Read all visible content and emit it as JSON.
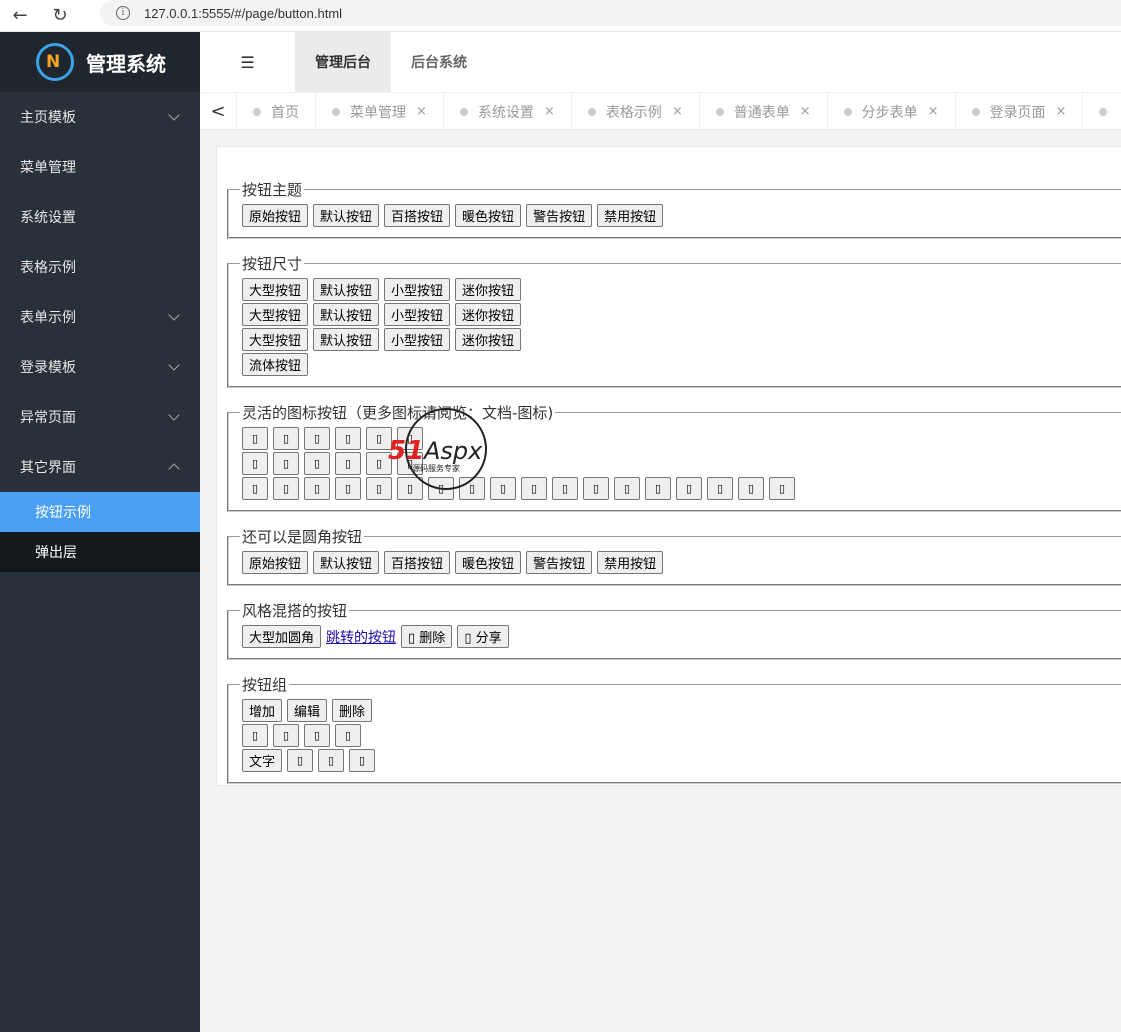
{
  "browser": {
    "url": "127.0.0.1:5555/#/page/button.html",
    "back_glyph": "←",
    "reload_glyph": "↻",
    "info_glyph": "i"
  },
  "logo": {
    "text": "管理系统",
    "mark": "N"
  },
  "sidebar": {
    "items": [
      {
        "label": "主页模板",
        "chevron": "down"
      },
      {
        "label": "菜单管理"
      },
      {
        "label": "系统设置"
      },
      {
        "label": "表格示例"
      },
      {
        "label": "表单示例",
        "chevron": "down"
      },
      {
        "label": "登录模板",
        "chevron": "down"
      },
      {
        "label": "异常页面",
        "chevron": "down"
      },
      {
        "label": "其它界面",
        "chevron": "up"
      }
    ],
    "subitems": [
      {
        "label": "按钮示例",
        "active": true
      },
      {
        "label": "弹出层"
      }
    ],
    "active_color": "#4aa0f5"
  },
  "header": {
    "menu_glyph": "☰",
    "tabs": [
      {
        "label": "管理后台",
        "active": true
      },
      {
        "label": "后台系统"
      }
    ]
  },
  "tabbar": {
    "prev_glyph": "<",
    "tabs": [
      {
        "label": "首页",
        "closable": false
      },
      {
        "label": "菜单管理",
        "closable": true
      },
      {
        "label": "系统设置",
        "closable": true
      },
      {
        "label": "表格示例",
        "closable": true
      },
      {
        "label": "普通表单",
        "closable": true
      },
      {
        "label": "分步表单",
        "closable": true
      },
      {
        "label": "登录页面",
        "closable": true
      }
    ],
    "close_glyph": "×"
  },
  "sections": {
    "theme": {
      "legend": "按钮主题",
      "buttons": [
        "原始按钮",
        "默认按钮",
        "百搭按钮",
        "暖色按钮",
        "警告按钮",
        "禁用按钮"
      ]
    },
    "size": {
      "legend": "按钮尺寸",
      "row1": [
        "大型按钮",
        "默认按钮",
        "小型按钮",
        "迷你按钮"
      ],
      "row2": [
        "大型按钮",
        "默认按钮",
        "小型按钮",
        "迷你按钮"
      ],
      "row3": [
        "大型按钮",
        "默认按钮",
        "小型按钮",
        "迷你按钮"
      ],
      "fluid": "流体按钮"
    },
    "icons": {
      "legend": "灵活的图标按钮（更多图标请阅览：文档-图标)",
      "icon_glyph": "▯"
    },
    "radius": {
      "legend": "还可以是圆角按钮",
      "buttons": [
        "原始按钮",
        "默认按钮",
        "百搭按钮",
        "暖色按钮",
        "警告按钮",
        "禁用按钮"
      ]
    },
    "mixed": {
      "legend": "风格混搭的按钮",
      "big_radius": "大型加圆角",
      "link": "跳转的按钮",
      "delete": "▯ 删除",
      "share": "▯ 分享"
    },
    "group": {
      "legend": "按钮组",
      "row1": [
        "增加",
        "编辑",
        "删除"
      ],
      "text_btn": "文字"
    }
  },
  "watermark": {
    "text": "51Aspx",
    "sub": "源码服务专家"
  }
}
